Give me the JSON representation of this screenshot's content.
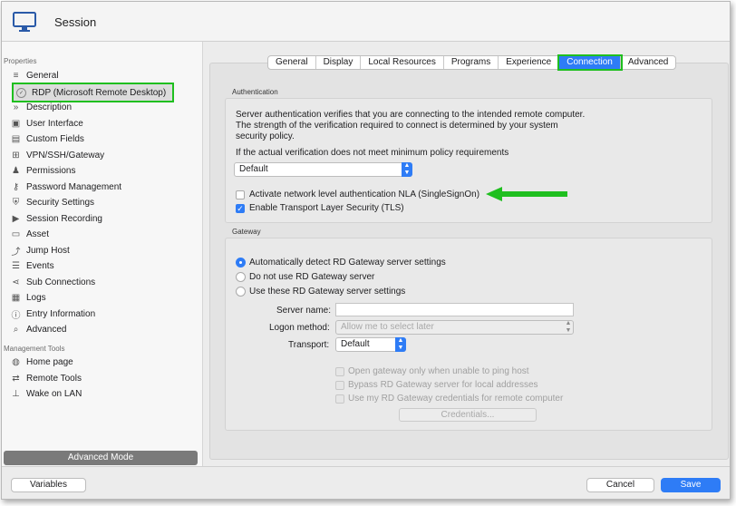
{
  "window": {
    "title": "Session"
  },
  "sidebar": {
    "properties_label": "Properties",
    "items": [
      {
        "label": "General",
        "icon": "list-icon"
      },
      {
        "label": "RDP (Microsoft Remote Desktop)",
        "icon": "rdp-icon"
      },
      {
        "label": "Description",
        "icon": "chevrons-icon"
      },
      {
        "label": "User Interface",
        "icon": "window-icon"
      },
      {
        "label": "Custom Fields",
        "icon": "fields-icon"
      },
      {
        "label": "VPN/SSH/Gateway",
        "icon": "vpn-icon"
      },
      {
        "label": "Permissions",
        "icon": "user-icon"
      },
      {
        "label": "Password Management",
        "icon": "key-icon"
      },
      {
        "label": "Security Settings",
        "icon": "shield-icon"
      },
      {
        "label": "Session Recording",
        "icon": "recording-icon"
      },
      {
        "label": "Asset",
        "icon": "monitor-icon"
      },
      {
        "label": "Jump Host",
        "icon": "jump-icon"
      },
      {
        "label": "Events",
        "icon": "events-icon"
      },
      {
        "label": "Sub Connections",
        "icon": "share-icon"
      },
      {
        "label": "Logs",
        "icon": "logs-icon"
      },
      {
        "label": "Entry Information",
        "icon": "info-icon"
      },
      {
        "label": "Advanced",
        "icon": "search-icon"
      }
    ],
    "management_label": "Management Tools",
    "tools": [
      {
        "label": "Home page",
        "icon": "globe-icon"
      },
      {
        "label": "Remote Tools",
        "icon": "tools-icon"
      },
      {
        "label": "Wake on LAN",
        "icon": "network-icon"
      }
    ],
    "advanced_mode": "Advanced Mode"
  },
  "tabs": [
    "General",
    "Display",
    "Local Resources",
    "Programs",
    "Experience",
    "Connection",
    "Advanced"
  ],
  "active_tab": "Connection",
  "authentication": {
    "label": "Authentication",
    "description_1": "Server authentication verifies that you are connecting to the intended remote computer.",
    "description_2": "The strength of the verification required to connect is determined by your system",
    "description_3": "security policy.",
    "policy_prompt": "If the actual verification does not meet minimum policy requirements",
    "policy_value": "Default",
    "nla_label": "Activate network level authentication NLA (SingleSignOn)",
    "nla_checked": false,
    "tls_label": "Enable Transport Layer Security (TLS)",
    "tls_checked": true
  },
  "gateway": {
    "label": "Gateway",
    "option_auto": "Automatically detect RD Gateway server settings",
    "option_none": "Do not use RD Gateway server",
    "option_use": "Use these RD Gateway server settings",
    "selected": "auto",
    "server_name_label": "Server name:",
    "server_name_value": "",
    "logon_method_label": "Logon method:",
    "logon_method_value": "Allow me to select later",
    "transport_label": "Transport:",
    "transport_value": "Default",
    "open_gateway_label": "Open gateway only when unable to ping host",
    "bypass_label": "Bypass RD Gateway server for local addresses",
    "use_credentials_label": "Use my RD Gateway credentials for remote computer",
    "credentials_button": "Credentials..."
  },
  "footer": {
    "variables": "Variables",
    "cancel": "Cancel",
    "save": "Save"
  },
  "colors": {
    "accent": "#2e7cf6",
    "highlight": "#1fbf1f"
  }
}
